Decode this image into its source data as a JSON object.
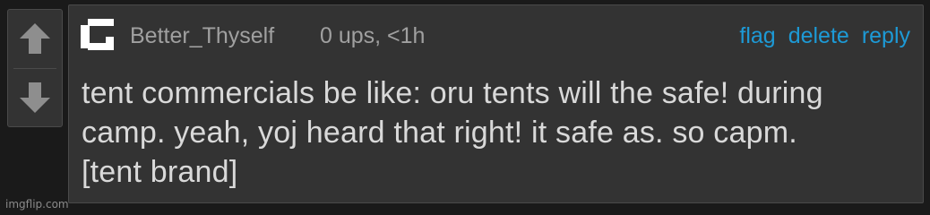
{
  "vote": {
    "up_icon": "arrow-up-icon",
    "down_icon": "arrow-down-icon"
  },
  "comment": {
    "avatar_icon": "user-avatar-icon",
    "username": "Better_Thyself",
    "meta": "0 ups, <1h",
    "actions": {
      "flag": "flag",
      "delete": "delete",
      "reply": "reply"
    },
    "text_lines": [
      "tent commercials be like: oru tents will the safe! during",
      "camp. yeah, yoj heard that right! it safe as. so capm.",
      "[tent brand]"
    ]
  },
  "watermark": "imgflip.com",
  "colors": {
    "background": "#1a1a1a",
    "panel": "#333333",
    "link": "#1d9ad6",
    "text": "#d9d9d9",
    "muted": "#a0a0a0"
  }
}
